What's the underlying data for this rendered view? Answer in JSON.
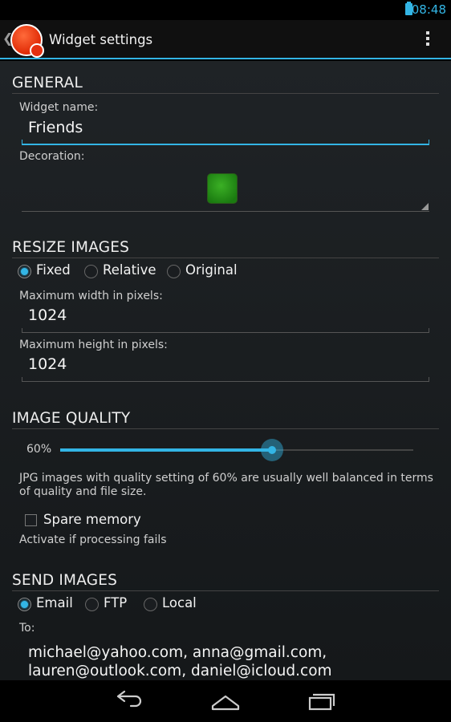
{
  "status_bar": {
    "time": "08:48"
  },
  "action_bar": {
    "title": "Widget settings"
  },
  "general": {
    "header": "GENERAL",
    "widget_name_label": "Widget name:",
    "widget_name_value": "Friends",
    "decoration_label": "Decoration:"
  },
  "resize": {
    "header": "RESIZE IMAGES",
    "options": [
      "Fixed",
      "Relative",
      "Original"
    ],
    "selected": "Fixed",
    "max_width_label": "Maximum width in pixels:",
    "max_width_value": "1024",
    "max_height_label": "Maximum height in pixels:",
    "max_height_value": "1024"
  },
  "quality": {
    "header": "IMAGE QUALITY",
    "value_label": "60%",
    "value_fraction": 0.6,
    "description": "JPG images with quality setting of 60% are usually well balanced in terms of quality and file size.",
    "spare_memory_label": "Spare memory",
    "spare_memory_checked": false,
    "spare_memory_hint": "Activate if processing fails"
  },
  "send": {
    "header": "SEND IMAGES",
    "options": [
      "Email",
      "FTP",
      "Local"
    ],
    "selected": "Email",
    "to_label": "To:",
    "recipients": "michael@yahoo.com, anna@gmail.com, lauren@outlook.com, daniel@icloud.com"
  },
  "colors": {
    "accent": "#33b5e5",
    "background": "#1f2326"
  },
  "icons": {
    "battery": "battery-icon",
    "logo": "app-logo-icon",
    "overflow": "overflow-menu-icon",
    "back": "back-icon",
    "home": "home-icon",
    "recents": "recents-icon"
  }
}
